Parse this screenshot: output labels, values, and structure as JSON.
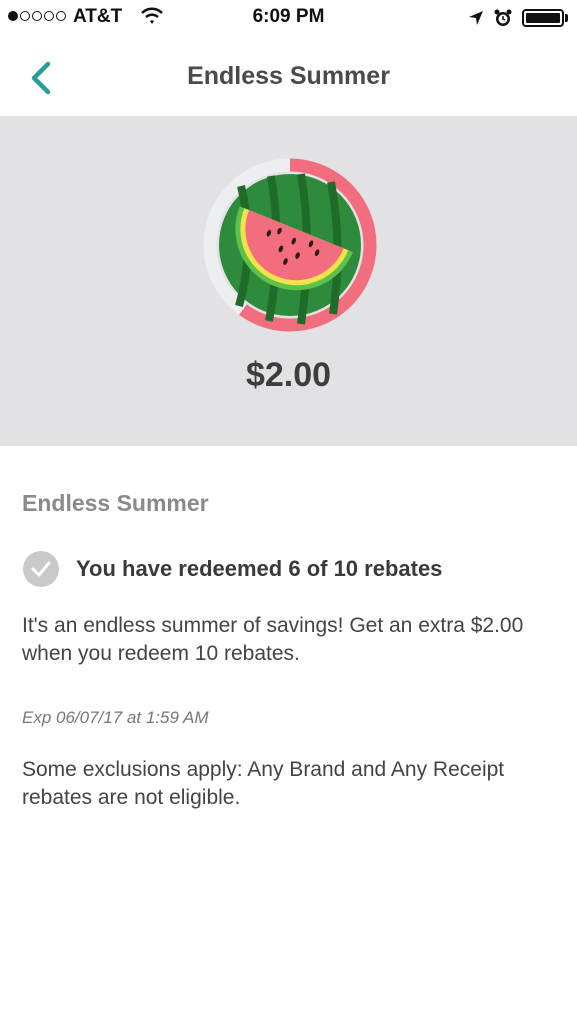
{
  "status_bar": {
    "carrier": "AT&T",
    "time": "6:09 PM",
    "signal_bars_filled": 1,
    "signal_bars_total": 5
  },
  "nav": {
    "title": "Endless Summer",
    "back_icon": "chevron-left-icon",
    "accent_color": "#2a9d9a"
  },
  "hero": {
    "amount": "$2.00",
    "badge_icon": "watermelon-icon",
    "progress_fraction": 0.6,
    "progress_color": "#f26d7d",
    "track_color": "#eceef2"
  },
  "details": {
    "title": "Endless Summer",
    "progress_text": "You have redeemed 6 of 10 rebates",
    "description": "It's an endless summer of savings! Get an extra $2.00 when you redeem 10 rebates.",
    "expiry": "Exp 06/07/17 at 1:59 AM",
    "exclusions": "Some exclusions apply: Any Brand and Any Receipt rebates are not eligible."
  }
}
